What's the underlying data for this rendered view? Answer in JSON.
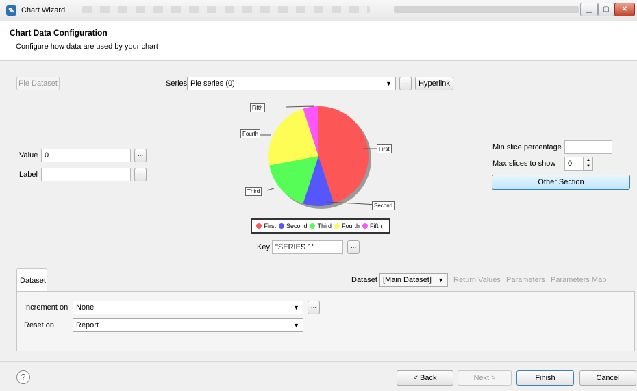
{
  "window": {
    "title": "Chart Wizard",
    "min_glyph": "▁",
    "max_glyph": "▢",
    "close_glyph": "✕"
  },
  "header": {
    "title": "Chart Data Configuration",
    "subtitle": "Configure how data are used by your chart"
  },
  "dataset_button": "Pie Dataset",
  "series": {
    "label": "Series",
    "value": "Pie series (0)",
    "dots": "...",
    "hyperlink": "Hyperlink"
  },
  "value_field": {
    "label": "Value",
    "value": "0",
    "dots": "..."
  },
  "label_field": {
    "label": "Label",
    "value": "",
    "dots": "..."
  },
  "chart_data": {
    "type": "pie",
    "categories": [
      "First",
      "Second",
      "Third",
      "Fourth",
      "Fifth"
    ],
    "values": [
      45,
      10,
      17,
      23,
      5
    ],
    "colors": [
      "#fd5656",
      "#5656fd",
      "#56fd56",
      "#fdfd56",
      "#fd56fd"
    ]
  },
  "key": {
    "label": "Key",
    "value": "\"SERIES 1\"",
    "dots": "..."
  },
  "right_panel": {
    "min_slice_label": "Min slice percentage",
    "min_slice_value": "",
    "max_slices_label": "Max slices to show",
    "max_slices_value": "0",
    "other_section": "Other Section"
  },
  "dataset_tab": {
    "tab_label": "Dataset",
    "dataset_label": "Dataset",
    "dataset_value": "[Main Dataset]",
    "links": [
      "Return Values",
      "Parameters",
      "Parameters Map"
    ],
    "increment_label": "Increment on",
    "increment_value": "None",
    "increment_dots": "...",
    "reset_label": "Reset on",
    "reset_value": "Report"
  },
  "footer": {
    "help": "?",
    "back": "< Back",
    "next": "Next >",
    "finish": "Finish",
    "cancel": "Cancel"
  }
}
